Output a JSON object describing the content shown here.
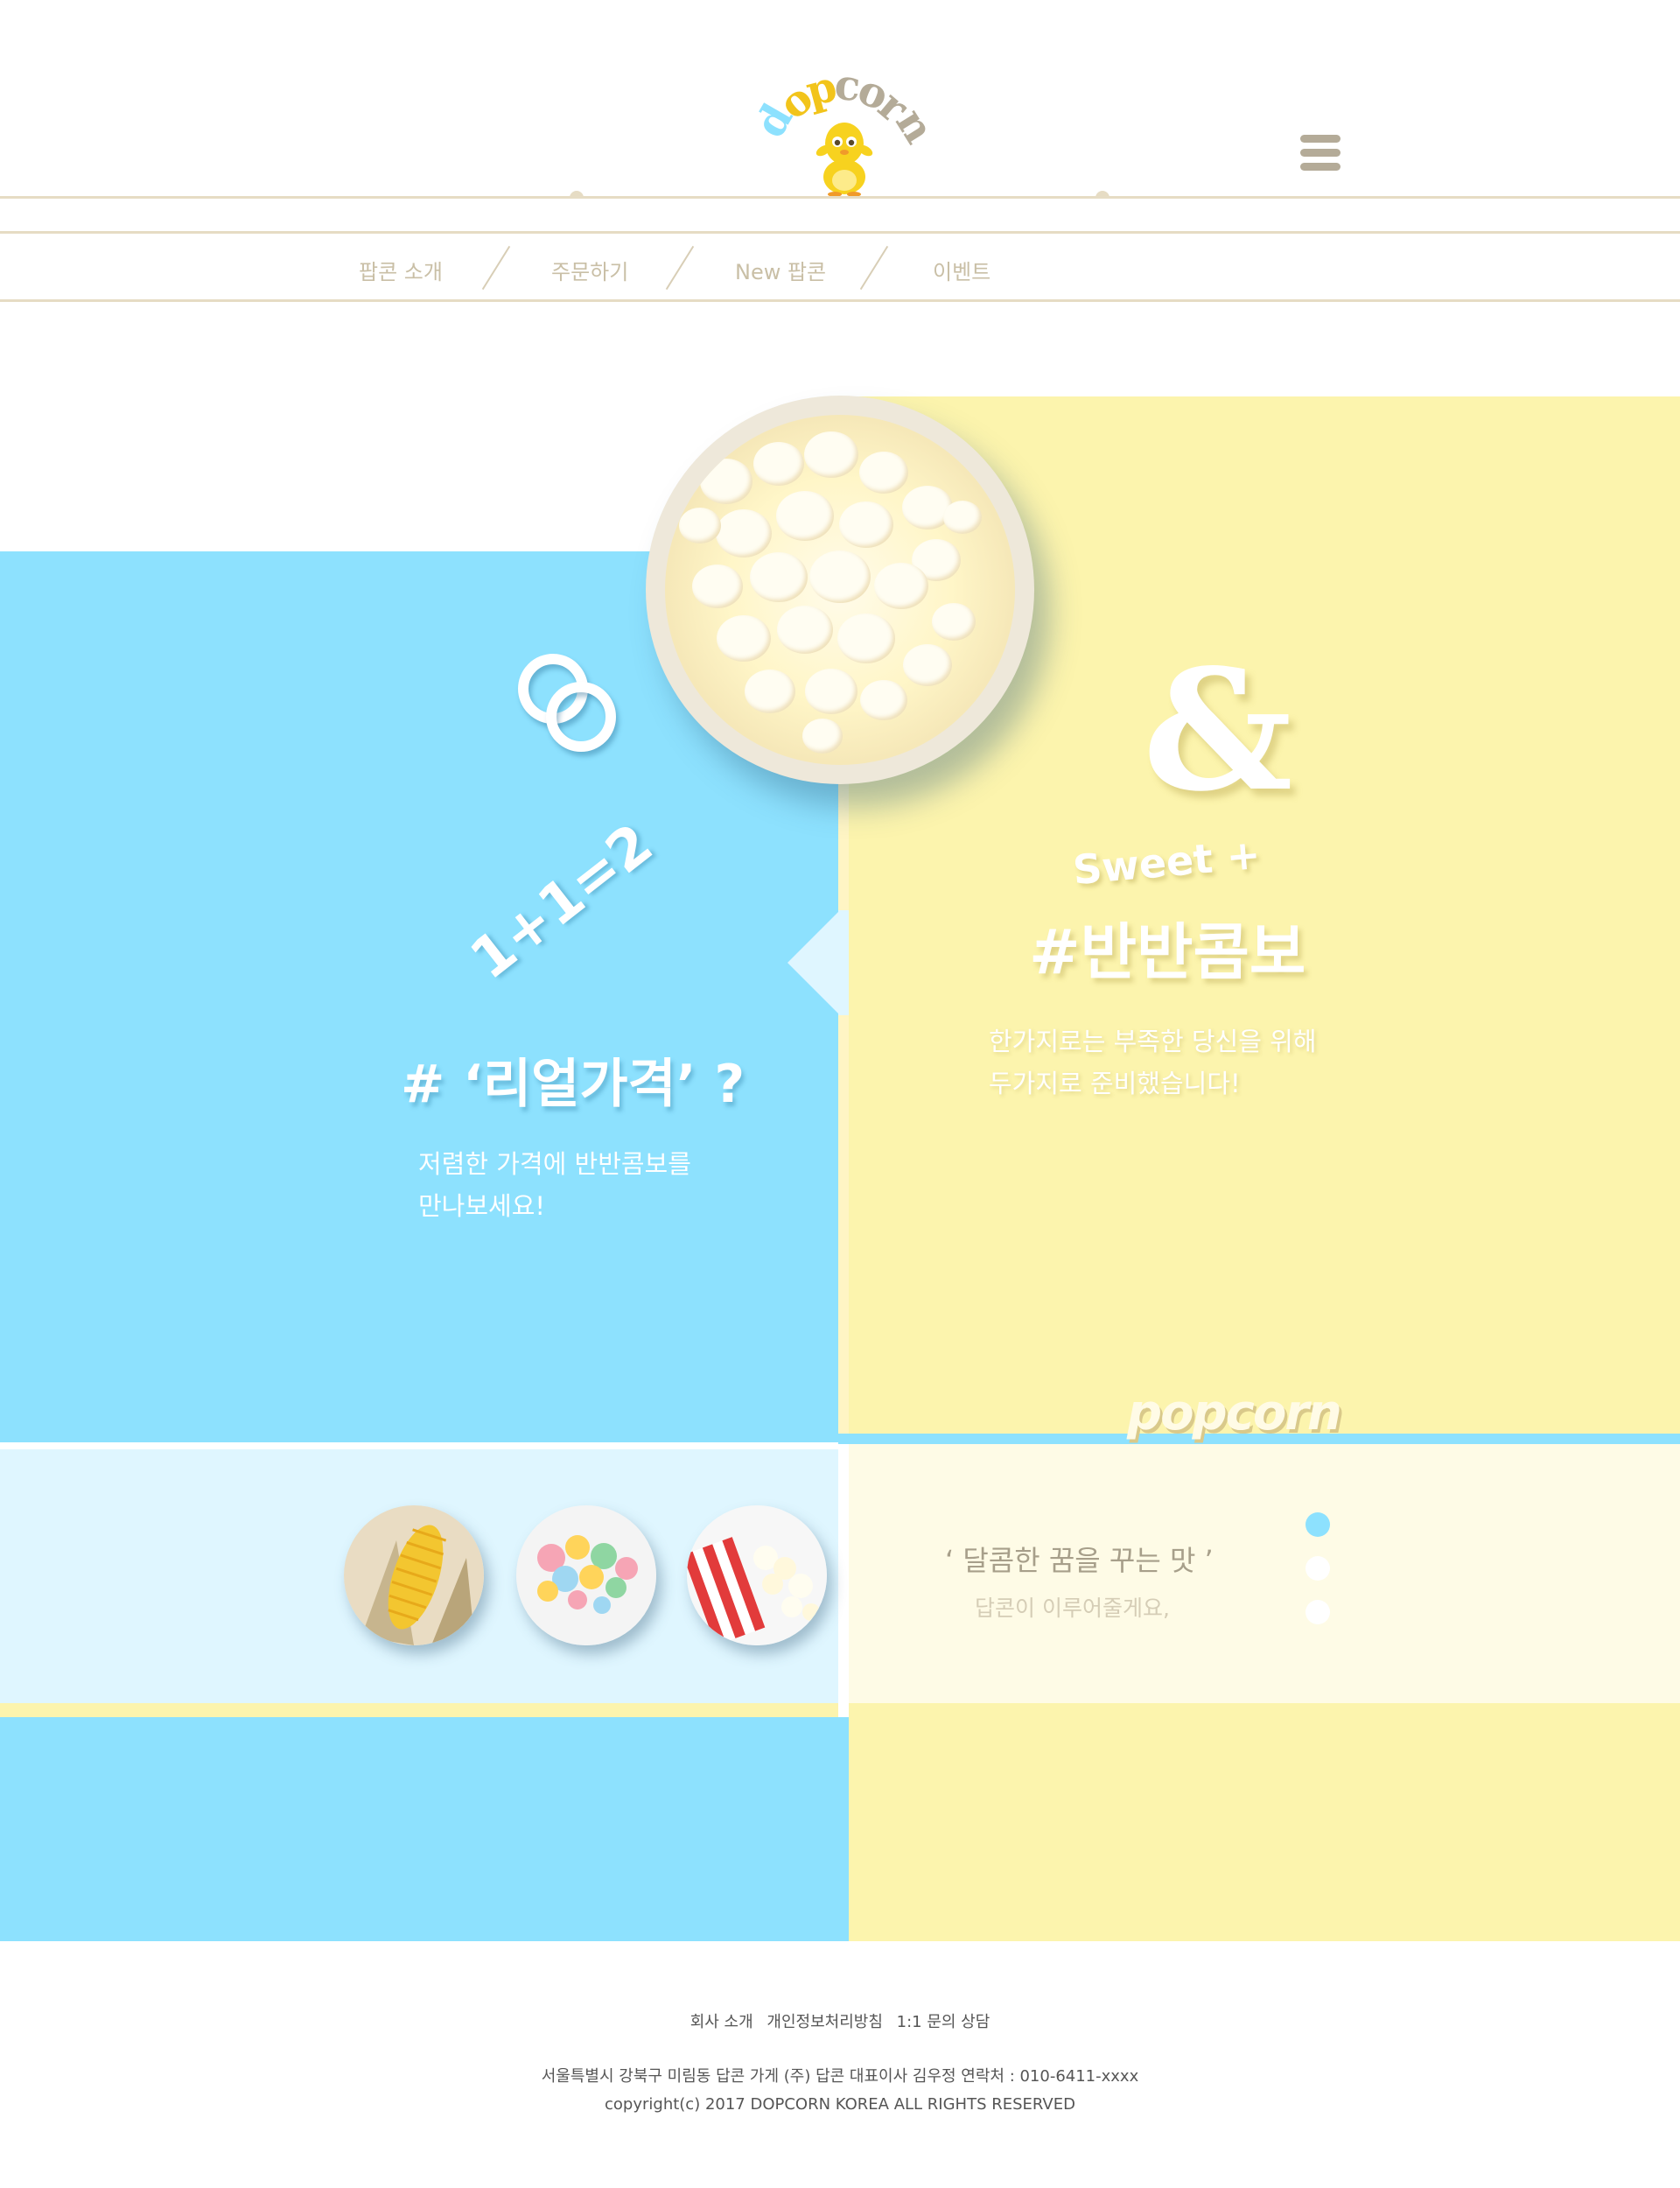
{
  "header": {
    "logo_letters": [
      "d",
      "o",
      "p",
      "c",
      "o",
      "r",
      "n"
    ],
    "nav": [
      "팝콘 소개",
      "주문하기",
      "New 팝콘",
      "이벤트"
    ]
  },
  "hero": {
    "equation": "1+1=2",
    "ampersand": "&",
    "sweet": "Sweet +",
    "combo_title": "#반반콤보",
    "combo_desc_1": "한가지로는 부족한 당신을 위해",
    "combo_desc_2": "두가지로 준비했습니다!",
    "real_price_title": "# ‘리얼가격’ ?",
    "real_price_desc_1": "저렴한 가격에 반반콤보를",
    "real_price_desc_2": "만나보세요!",
    "brand_mark": "popcorn"
  },
  "features": {
    "thumbnails": [
      "corn-image",
      "caramel-popcorn-image",
      "popcorn-box-image"
    ],
    "quote": "‘ 달콤한 꿈을 꾸는 맛 ’",
    "quote_sub": "답콘이 이루어줄게요,",
    "pager_count": 3,
    "pager_active": 1
  },
  "footer": {
    "links": [
      "회사 소개",
      "개인정보처리방침",
      "1:1 문의 상담"
    ],
    "address": "서울특별시 강북구 미림동 답콘 가게  (주) 답콘 대표이사 김우정 연락처 : 010-6411-xxxx",
    "copyright": "copyright(c) 2017 DOPCORN KOREA ALL RIGHTS RESERVED"
  },
  "colors": {
    "blue": "#8de1fe",
    "yellow": "#fcf4ad",
    "beige_line": "#e6dcc4",
    "nav_text": "#c9bfa6",
    "pager_active": "#8de1fe"
  }
}
